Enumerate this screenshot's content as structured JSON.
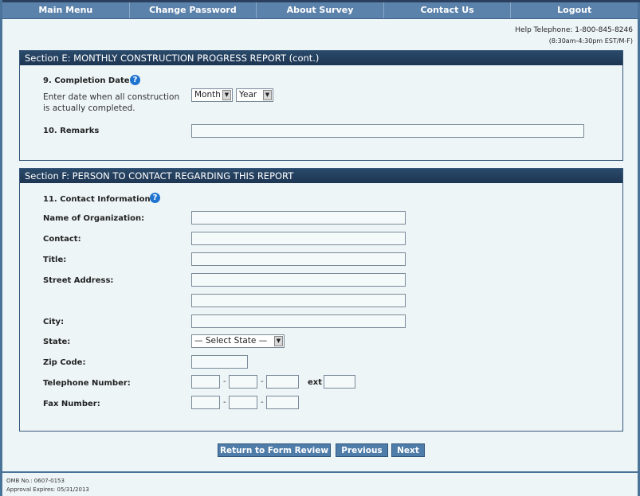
{
  "nav": [
    "Main Menu",
    "Change Password",
    "About Survey",
    "Contact Us",
    "Logout"
  ],
  "help": {
    "phone": "Help Telephone: 1-800-845-8246",
    "hours": "(8:30am-4:30pm EST/M-F)"
  },
  "sectionE": {
    "title": "Section E: MONTHLY CONSTRUCTION PROGRESS REPORT (cont.)",
    "q9": "9. Completion Date",
    "q9_desc1": "Enter date when all construction",
    "q9_desc2": "is actually completed.",
    "month": "Month",
    "year": "Year",
    "q10": "10. Remarks"
  },
  "sectionF": {
    "title": "Section F: PERSON TO CONTACT REGARDING THIS REPORT",
    "q11": "11. Contact Information",
    "org": "Name of Organization:",
    "contact": "Contact:",
    "title_label": "Title:",
    "street": "Street Address:",
    "city": "City:",
    "state": "State:",
    "state_value": "— Select State —",
    "zip": "Zip Code:",
    "tel": "Telephone Number:",
    "ext": "ext",
    "fax": "Fax Number:",
    "dash": "-"
  },
  "buttons": {
    "return": "Return to Form Review",
    "previous": "Previous",
    "next": "Next"
  },
  "footer": {
    "omb": "OMB No.: 0607-0153",
    "expires": "Approval Expires: 05/31/2013"
  },
  "help_icon": "?"
}
